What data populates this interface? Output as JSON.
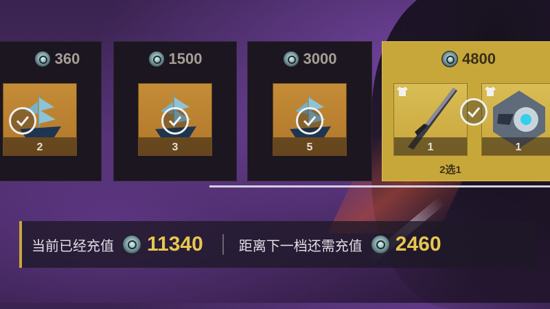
{
  "tiers": [
    {
      "cost": "360",
      "items": [
        {
          "qty": "2",
          "type": "ship"
        }
      ],
      "claimed": true
    },
    {
      "cost": "1500",
      "items": [
        {
          "qty": "3",
          "type": "ship"
        }
      ],
      "claimed": true
    },
    {
      "cost": "3000",
      "items": [
        {
          "qty": "5",
          "type": "ship"
        }
      ],
      "claimed": true
    },
    {
      "cost": "4800",
      "items": [
        {
          "qty": "1",
          "type": "blade"
        },
        {
          "qty": "1",
          "type": "emblem"
        }
      ],
      "claimed": true,
      "choose_label": "2选1"
    }
  ],
  "status": {
    "current_label": "当前已经充值",
    "current_value": "11340",
    "next_label": "距离下一档还需充值",
    "next_value": "2460"
  },
  "colors": {
    "accent_gold": "#c8a73a",
    "value_gold": "#e8c64f",
    "card_dark": "#1b1620"
  }
}
